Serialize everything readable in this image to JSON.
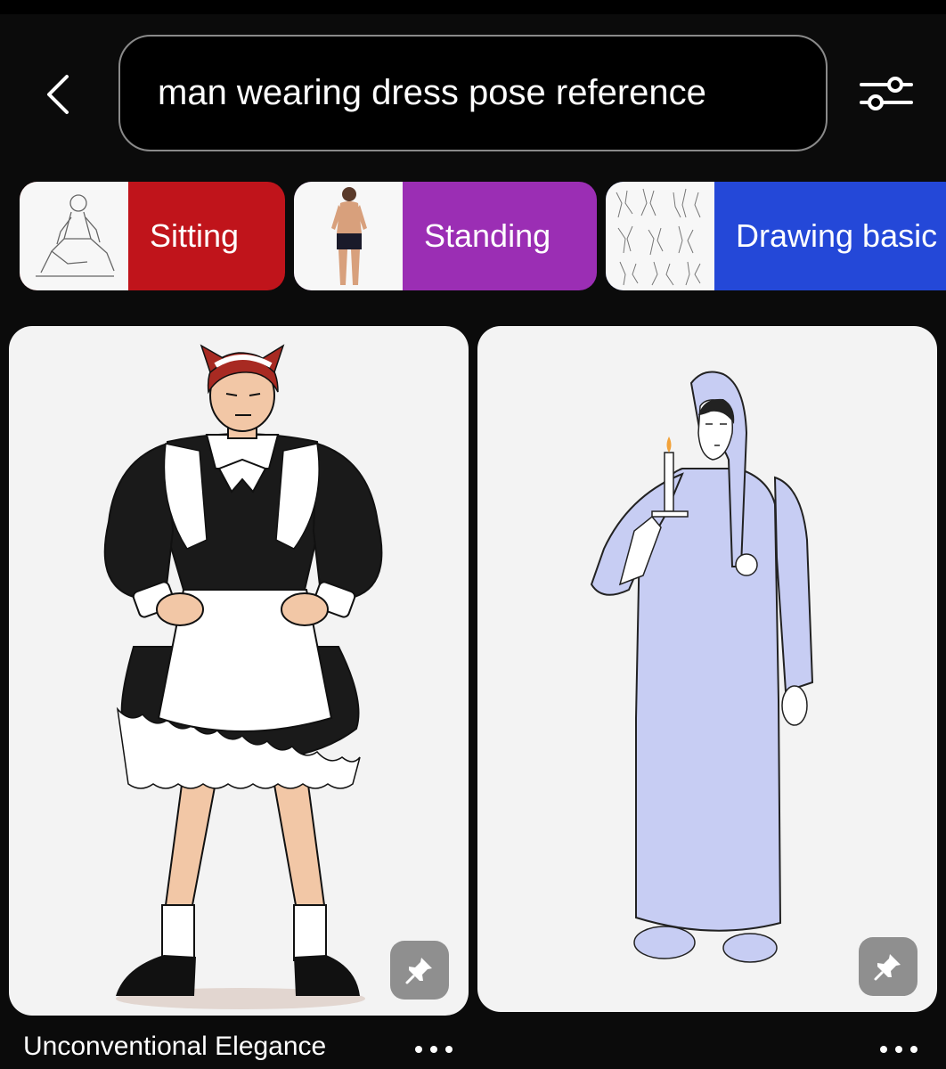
{
  "search": {
    "query": "man wearing dress pose reference"
  },
  "icons": {
    "back": "chevron-left-icon",
    "filter": "sliders-icon",
    "pin": "pin-icon",
    "more": "more-horizontal-icon"
  },
  "chips": [
    {
      "label": "Sitting",
      "color": "#c0141b"
    },
    {
      "label": "Standing",
      "color": "#9b2eb4"
    },
    {
      "label": "Drawing basic",
      "color": "#2448d8"
    }
  ],
  "pins": [
    {
      "title": "Unconventional Elegance"
    },
    {
      "title": ""
    }
  ]
}
